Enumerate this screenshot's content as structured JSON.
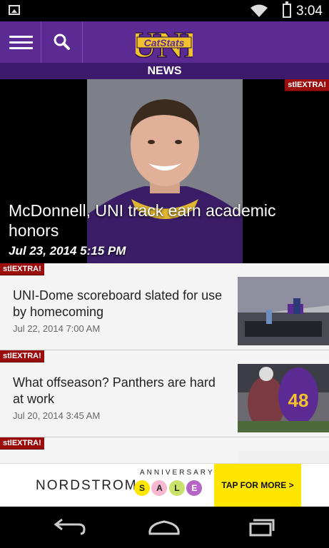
{
  "status_bar": {
    "time": "3:04",
    "icons": [
      "image-icon",
      "wifi-icon",
      "battery-charging-icon"
    ]
  },
  "app_bar": {
    "logo_line1": "CatStats",
    "logo_line2": "UNI",
    "section": "NEWS",
    "colors": {
      "primary": "#5b2a93",
      "dark": "#3d1a6b",
      "logo_gold": "#f2c12e"
    }
  },
  "hero": {
    "badge": "stlEXTRA!",
    "title": "McDonnell, UNI track earn academic honors",
    "date": "Jul 23, 2014 5:15 PM"
  },
  "articles": [
    {
      "badge": "stlEXTRA!",
      "title": "UNI-Dome scoreboard slated for use by homecoming",
      "date": "Jul 22, 2014 7:00 AM"
    },
    {
      "badge": "stlEXTRA!",
      "title": "What offseason? Panthers are hard at work",
      "date": "Jul 20, 2014 3:45 AM"
    },
    {
      "badge": "stlEXTRA!",
      "title": "",
      "date": ""
    }
  ],
  "ad": {
    "brand": "NORDSTROM",
    "tagline": "ANNIVERSARY",
    "sale_letters": [
      "S",
      "A",
      "L",
      "E"
    ],
    "cta": "TAP FOR MORE >"
  },
  "nav": {
    "icons": [
      "back-icon",
      "home-icon",
      "recents-icon"
    ]
  }
}
